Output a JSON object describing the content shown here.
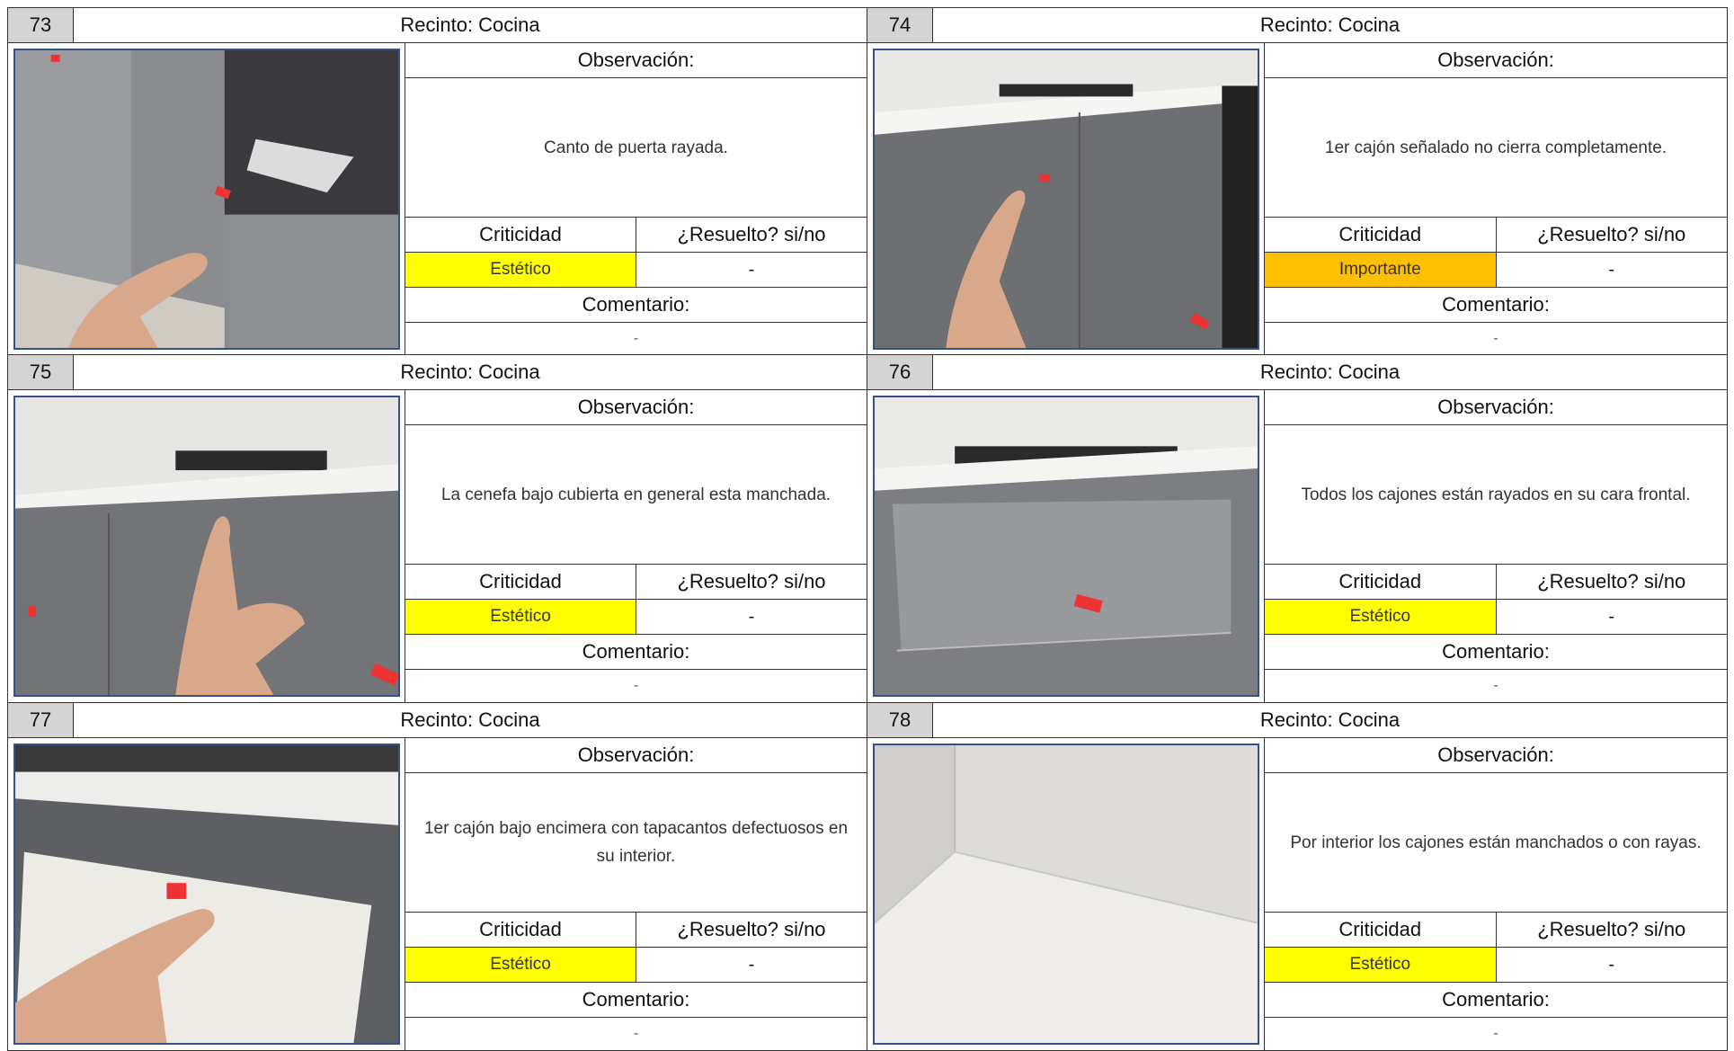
{
  "labels": {
    "observacion": "Observación:",
    "criticidad": "Criticidad",
    "resuelto": "¿Resuelto? si/no",
    "comentario": "Comentario:"
  },
  "colors": {
    "estetico": "#ffff00",
    "importante": "#ffc000"
  },
  "items": [
    {
      "number": "73",
      "recinto": "Recinto: Cocina",
      "observacion": "Canto de puerta rayada.",
      "criticidad": "Estético",
      "criticidad_color": "#ffff00",
      "resuelto": "-",
      "comentario": "-"
    },
    {
      "number": "74",
      "recinto": "Recinto: Cocina",
      "observacion": "1er cajón señalado no cierra completamente.",
      "criticidad": "Importante",
      "criticidad_color": "#ffc000",
      "resuelto": "-",
      "comentario": "-"
    },
    {
      "number": "75",
      "recinto": "Recinto: Cocina",
      "observacion": "La cenefa bajo cubierta en general esta manchada.",
      "criticidad": "Estético",
      "criticidad_color": "#ffff00",
      "resuelto": "-",
      "comentario": "-"
    },
    {
      "number": "76",
      "recinto": "Recinto: Cocina",
      "observacion": "Todos los cajones están rayados en su cara frontal.",
      "criticidad": "Estético",
      "criticidad_color": "#ffff00",
      "resuelto": "-",
      "comentario": "-"
    },
    {
      "number": "77",
      "recinto": "Recinto: Cocina",
      "observacion": "1er cajón bajo encimera con tapacantos defectuosos en su interior.",
      "criticidad": "Estético",
      "criticidad_color": "#ffff00",
      "resuelto": "-",
      "comentario": "-"
    },
    {
      "number": "78",
      "recinto": "Recinto: Cocina",
      "observacion": "Por interior los cajones están manchados o con rayas.",
      "criticidad": "Estético",
      "criticidad_color": "#ffff00",
      "resuelto": "-",
      "comentario": "-"
    }
  ]
}
